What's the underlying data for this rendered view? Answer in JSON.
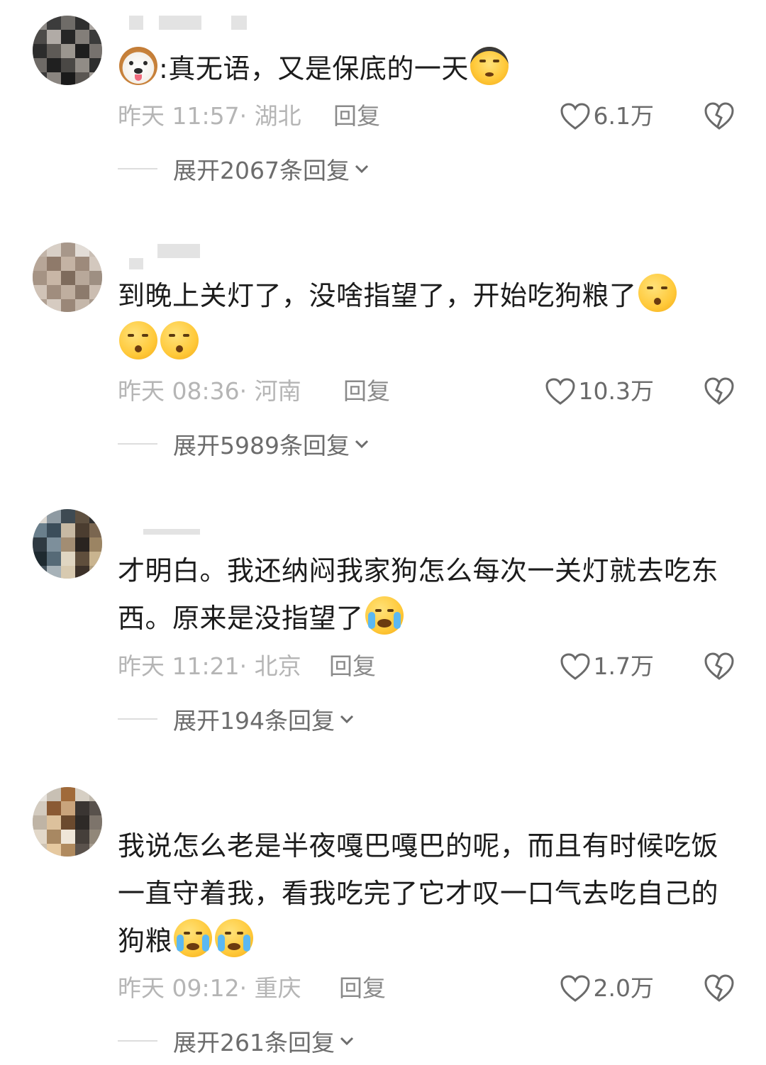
{
  "comments": [
    {
      "text": "真无语，又是保底的一天",
      "emoji_prefix": "puppy-emoji",
      "emoji_prefix_sep": ":",
      "emoji_suffix": [
        "headphones-emoji"
      ],
      "time": "昨天 11:57",
      "location": "湖北",
      "reply_label": "回复",
      "likes": "6.1万",
      "expand_label": "展开2067条回复"
    },
    {
      "text": "到晚上关灯了，没啥指望了，开始吃狗粮了",
      "emoji_suffix": [
        "shush-emoji",
        "shush-emoji",
        "shush-emoji"
      ],
      "time": "昨天 08:36",
      "location": "河南",
      "reply_label": "回复",
      "likes": "10.3万",
      "expand_label": "展开5989条回复"
    },
    {
      "text": "才明白。我还纳闷我家狗怎么每次一关灯就去吃东西。原来是没指望了",
      "emoji_suffix": [
        "laugh-cry-emoji"
      ],
      "time": "昨天 11:21",
      "location": "北京",
      "reply_label": "回复",
      "likes": "1.7万",
      "expand_label": "展开194条回复"
    },
    {
      "text": "我说怎么老是半夜嘎巴嘎巴的呢，而且有时候吃饭一直守着我，看我吃完了它才叹一口气去吃自己的狗粮",
      "emoji_suffix": [
        "crying-emoji",
        "crying-emoji"
      ],
      "time": "昨天 09:12",
      "location": "重庆",
      "reply_label": "回复",
      "likes": "2.0万",
      "expand_label": "展开261条回复"
    }
  ],
  "meta_separator": "·",
  "colors": {
    "text": "#1c1c1c",
    "meta": "#b5b5b5",
    "reply": "#8a8a8a",
    "expand": "#6c6c6c"
  }
}
